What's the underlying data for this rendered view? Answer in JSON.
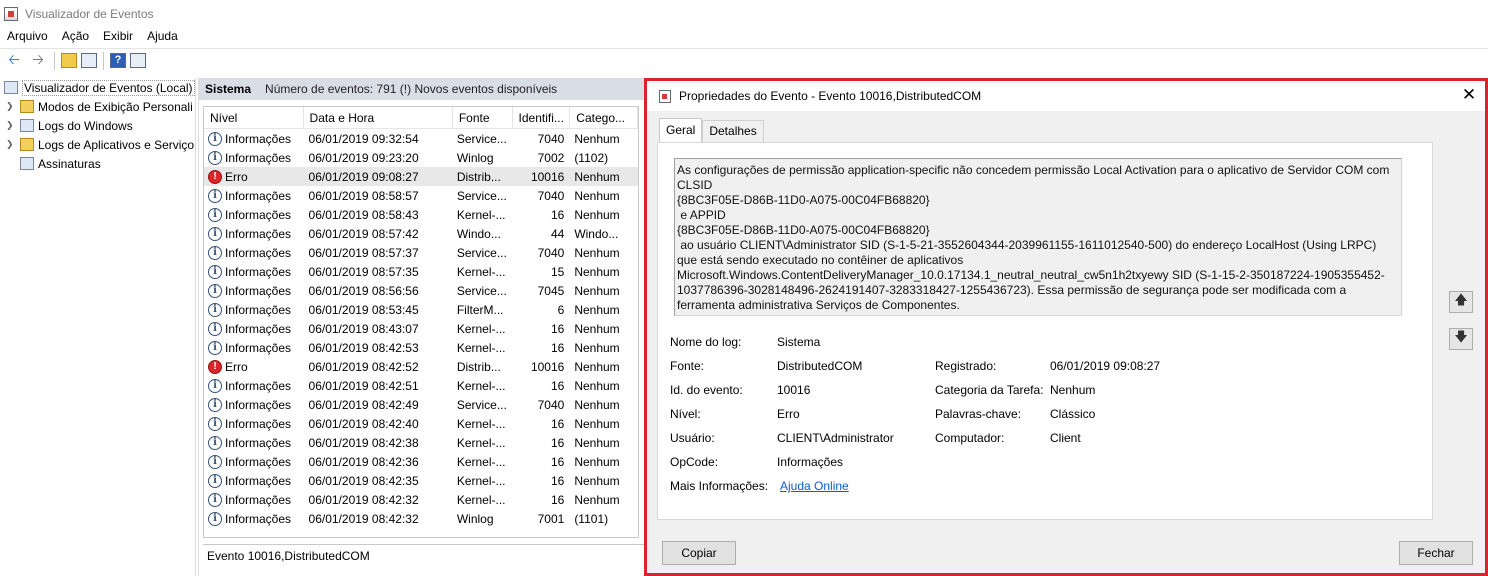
{
  "app": {
    "title": "Visualizador de Eventos"
  },
  "menu": [
    "Arquivo",
    "Ação",
    "Exibir",
    "Ajuda"
  ],
  "tree": {
    "root": "Visualizador de Eventos (Local)",
    "items": [
      {
        "label": "Modos de Exibição Personali",
        "expandable": true
      },
      {
        "label": "Logs do Windows",
        "expandable": true
      },
      {
        "label": "Logs de Aplicativos e Serviço",
        "expandable": true
      },
      {
        "label": "Assinaturas",
        "expandable": false
      }
    ]
  },
  "center": {
    "header_name": "Sistema",
    "header_count": "Número de eventos: 791 (!) Novos eventos disponíveis",
    "columns": [
      "Nível",
      "Data e Hora",
      "Fonte",
      "Identifi...",
      "Catego..."
    ],
    "rows": [
      {
        "level": "Informações",
        "date": "06/01/2019 09:32:54",
        "source": "Service...",
        "id": "7040",
        "cat": "Nenhum",
        "type": "info"
      },
      {
        "level": "Informações",
        "date": "06/01/2019 09:23:20",
        "source": "Winlog",
        "id": "7002",
        "cat": "(1102)",
        "type": "info"
      },
      {
        "level": "Erro",
        "date": "06/01/2019 09:08:27",
        "source": "Distrib...",
        "id": "10016",
        "cat": "Nenhum",
        "type": "error",
        "selected": true
      },
      {
        "level": "Informações",
        "date": "06/01/2019 08:58:57",
        "source": "Service...",
        "id": "7040",
        "cat": "Nenhum",
        "type": "info"
      },
      {
        "level": "Informações",
        "date": "06/01/2019 08:58:43",
        "source": "Kernel-...",
        "id": "16",
        "cat": "Nenhum",
        "type": "info"
      },
      {
        "level": "Informações",
        "date": "06/01/2019 08:57:42",
        "source": "Windo...",
        "id": "44",
        "cat": "Windo...",
        "type": "info"
      },
      {
        "level": "Informações",
        "date": "06/01/2019 08:57:37",
        "source": "Service...",
        "id": "7040",
        "cat": "Nenhum",
        "type": "info"
      },
      {
        "level": "Informações",
        "date": "06/01/2019 08:57:35",
        "source": "Kernel-...",
        "id": "15",
        "cat": "Nenhum",
        "type": "info"
      },
      {
        "level": "Informações",
        "date": "06/01/2019 08:56:56",
        "source": "Service...",
        "id": "7045",
        "cat": "Nenhum",
        "type": "info"
      },
      {
        "level": "Informações",
        "date": "06/01/2019 08:53:45",
        "source": "FilterM...",
        "id": "6",
        "cat": "Nenhum",
        "type": "info"
      },
      {
        "level": "Informações",
        "date": "06/01/2019 08:43:07",
        "source": "Kernel-...",
        "id": "16",
        "cat": "Nenhum",
        "type": "info"
      },
      {
        "level": "Informações",
        "date": "06/01/2019 08:42:53",
        "source": "Kernel-...",
        "id": "16",
        "cat": "Nenhum",
        "type": "info"
      },
      {
        "level": "Erro",
        "date": "06/01/2019 08:42:52",
        "source": "Distrib...",
        "id": "10016",
        "cat": "Nenhum",
        "type": "error"
      },
      {
        "level": "Informações",
        "date": "06/01/2019 08:42:51",
        "source": "Kernel-...",
        "id": "16",
        "cat": "Nenhum",
        "type": "info"
      },
      {
        "level": "Informações",
        "date": "06/01/2019 08:42:49",
        "source": "Service...",
        "id": "7040",
        "cat": "Nenhum",
        "type": "info"
      },
      {
        "level": "Informações",
        "date": "06/01/2019 08:42:40",
        "source": "Kernel-...",
        "id": "16",
        "cat": "Nenhum",
        "type": "info"
      },
      {
        "level": "Informações",
        "date": "06/01/2019 08:42:38",
        "source": "Kernel-...",
        "id": "16",
        "cat": "Nenhum",
        "type": "info"
      },
      {
        "level": "Informações",
        "date": "06/01/2019 08:42:36",
        "source": "Kernel-...",
        "id": "16",
        "cat": "Nenhum",
        "type": "info"
      },
      {
        "level": "Informações",
        "date": "06/01/2019 08:42:35",
        "source": "Kernel-...",
        "id": "16",
        "cat": "Nenhum",
        "type": "info"
      },
      {
        "level": "Informações",
        "date": "06/01/2019 08:42:32",
        "source": "Kernel-...",
        "id": "16",
        "cat": "Nenhum",
        "type": "info"
      },
      {
        "level": "Informações",
        "date": "06/01/2019 08:42:32",
        "source": "Winlog",
        "id": "7001",
        "cat": "(1101)",
        "type": "info"
      }
    ],
    "detail_title": "Evento 10016,DistributedCOM"
  },
  "dialog": {
    "title": "Propriedades do Evento - Evento 10016,DistributedCOM",
    "tabs": [
      "Geral",
      "Detalhes"
    ],
    "description": "As configurações de permissão application-specific não concedem permissão Local Activation para o aplicativo de Servidor COM com CLSID\n{8BC3F05E-D86B-11D0-A075-00C04FB68820}\n e APPID\n{8BC3F05E-D86B-11D0-A075-00C04FB68820}\n ao usuário CLIENT\\Administrator SID (S-1-5-21-3552604344-2039961155-1611012540-500) do endereço LocalHost (Using LRPC) que está sendo executado no contêiner de aplicativos Microsoft.Windows.ContentDeliveryManager_10.0.17134.1_neutral_neutral_cw5n1h2txyewy SID (S-1-15-2-350187224-1905355452-1037786396-3028148496-2624191407-3283318427-1255436723). Essa permissão de segurança pode ser modificada com a ferramenta administrativa Serviços de Componentes.",
    "fields": {
      "log_name_label": "Nome do log:",
      "log_name": "Sistema",
      "source_label": "Fonte:",
      "source": "DistributedCOM",
      "logged_label": "Registrado:",
      "logged": "06/01/2019 09:08:27",
      "event_id_label": "Id. do evento:",
      "event_id": "10016",
      "task_label": "Categoria da Tarefa:",
      "task": "Nenhum",
      "level_label": "Nível:",
      "level": "Erro",
      "keywords_label": "Palavras-chave:",
      "keywords": "Clássico",
      "user_label": "Usuário:",
      "user": "CLIENT\\Administrator",
      "computer_label": "Computador:",
      "computer": "Client",
      "opcode_label": "OpCode:",
      "opcode": "Informações",
      "more_info_label": "Mais Informações:",
      "more_info_link": "Ajuda Online"
    },
    "copy_button": "Copiar",
    "close_button": "Fechar"
  },
  "colors": {
    "highlight_border": "#d9232e",
    "link": "#0b5bd3",
    "error_icon": "#d8262b"
  }
}
